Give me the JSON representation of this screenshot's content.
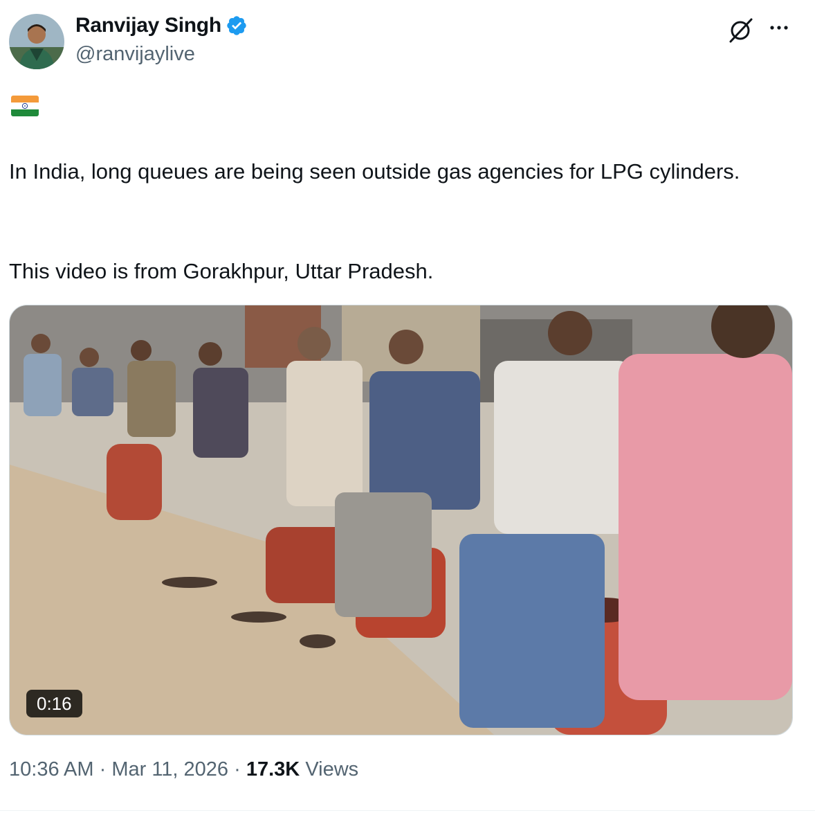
{
  "author": {
    "name": "Ranvijay Singh",
    "handle": "@ranvijaylive",
    "verified_color": "#1d9bf0"
  },
  "icons": [
    "grok-icon",
    "more-options-icon",
    "verified-badge-icon",
    "india-flag-emoji"
  ],
  "tweet": {
    "line1": "In India, long queues are being seen outside gas agencies for LPG cylinders.",
    "line2": "This video is from Gorakhpur, Uttar Pradesh."
  },
  "video": {
    "duration": "0:16"
  },
  "meta": {
    "time": "10:36 AM",
    "sep1": "·",
    "date": "Mar 11, 2026",
    "sep2": "·",
    "views_count": "17.3K",
    "views_label": "Views"
  }
}
